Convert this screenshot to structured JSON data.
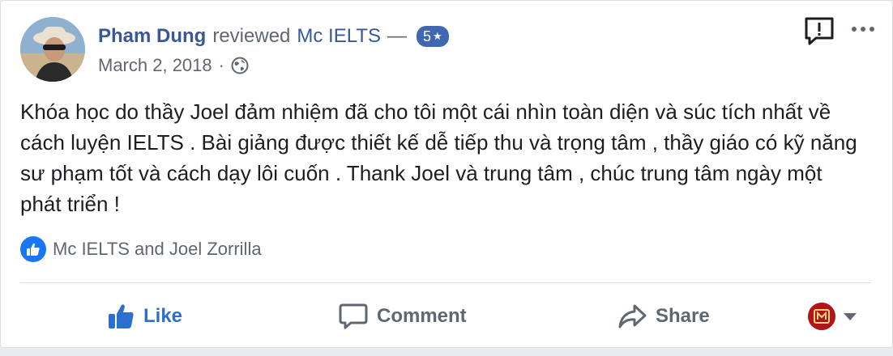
{
  "review": {
    "author": "Pham Dung",
    "action_text": "reviewed",
    "page_name": "Mc IELTS",
    "separator": "—",
    "rating": "5",
    "rating_icon": "star-icon",
    "date": "March 2, 2018",
    "dot": "·",
    "audience_icon": "globe-icon",
    "text": "Khóa học do thầy Joel đảm nhiệm đã cho tôi một cái nhìn toàn diện và súc tích nhất về cách luyện IELTS . Bài giảng được thiết kế dễ tiếp thu và trọng tâm , thầy giáo có kỹ năng sư phạm tốt và cách dạy lôi cuốn . Thank Joel và trung tâm , chúc trung tâm ngày một phát triển !"
  },
  "reactions": {
    "icon": "like-icon",
    "text": "Mc IELTS and Joel Zorrilla"
  },
  "actions": {
    "like": "Like",
    "comment": "Comment",
    "share": "Share"
  },
  "colors": {
    "link": "#385898",
    "like_active": "#2d6fcf",
    "badge_blue": "#4267b2",
    "secondary_text": "#606770",
    "body_text": "#1c1e21"
  }
}
